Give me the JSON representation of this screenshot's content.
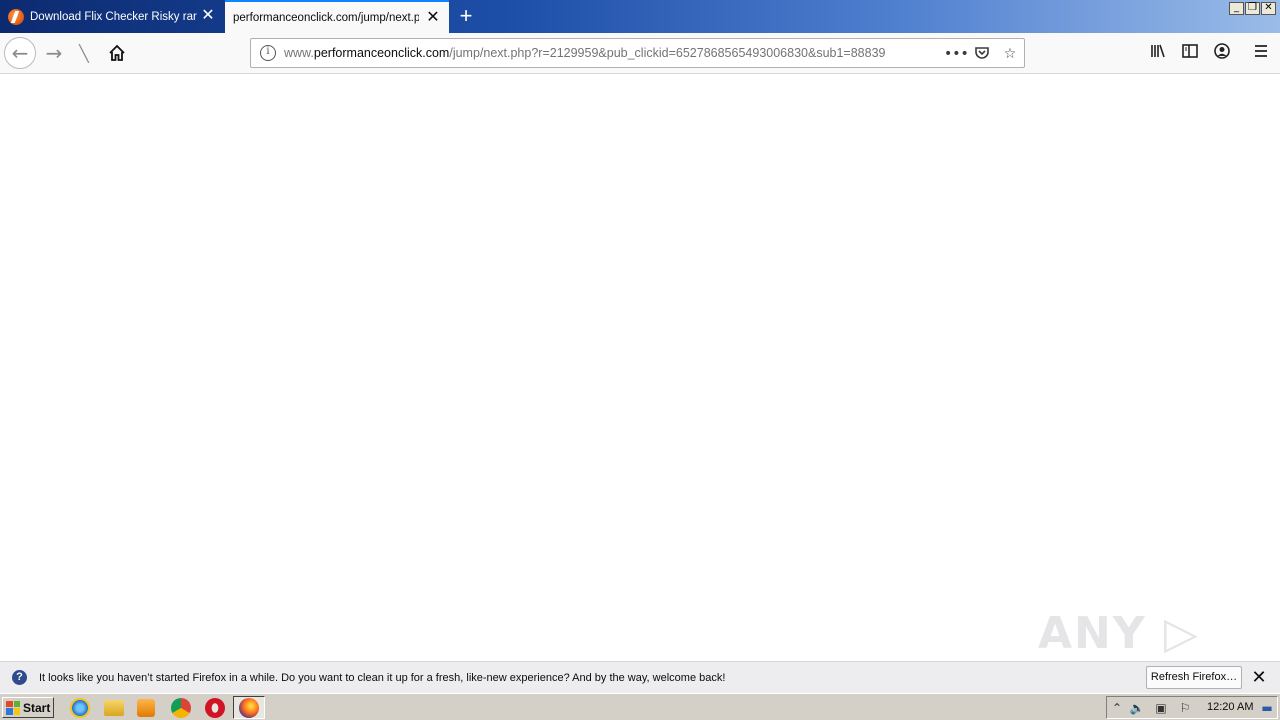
{
  "tabs": [
    {
      "title": "Download Flix Checker Risky rar",
      "active": false
    },
    {
      "title": "performanceonclick.com/jump/next.php",
      "active": true
    }
  ],
  "window_buttons": {
    "minimize": "_",
    "restore": "❐",
    "close": "✕"
  },
  "nav": {
    "url_prefix": "www.",
    "url_host": "performanceonclick.com",
    "url_path": "/jump/next.php?r=2129959&pub_clickid=6527868565493006830&sub1=88839"
  },
  "watermark": "ANY ▷ RUN",
  "notification": {
    "text": "It looks like you haven’t started Firefox in a while. Do you want to clean it up for a fresh, like-new experience? And by the way, welcome back!",
    "button_label": "Refresh Firefox…"
  },
  "taskbar": {
    "start_label": "Start",
    "clock": "12:20 AM"
  },
  "colors": {
    "accent": "#0a84ff",
    "notif_icon": "#2e4c8c"
  }
}
